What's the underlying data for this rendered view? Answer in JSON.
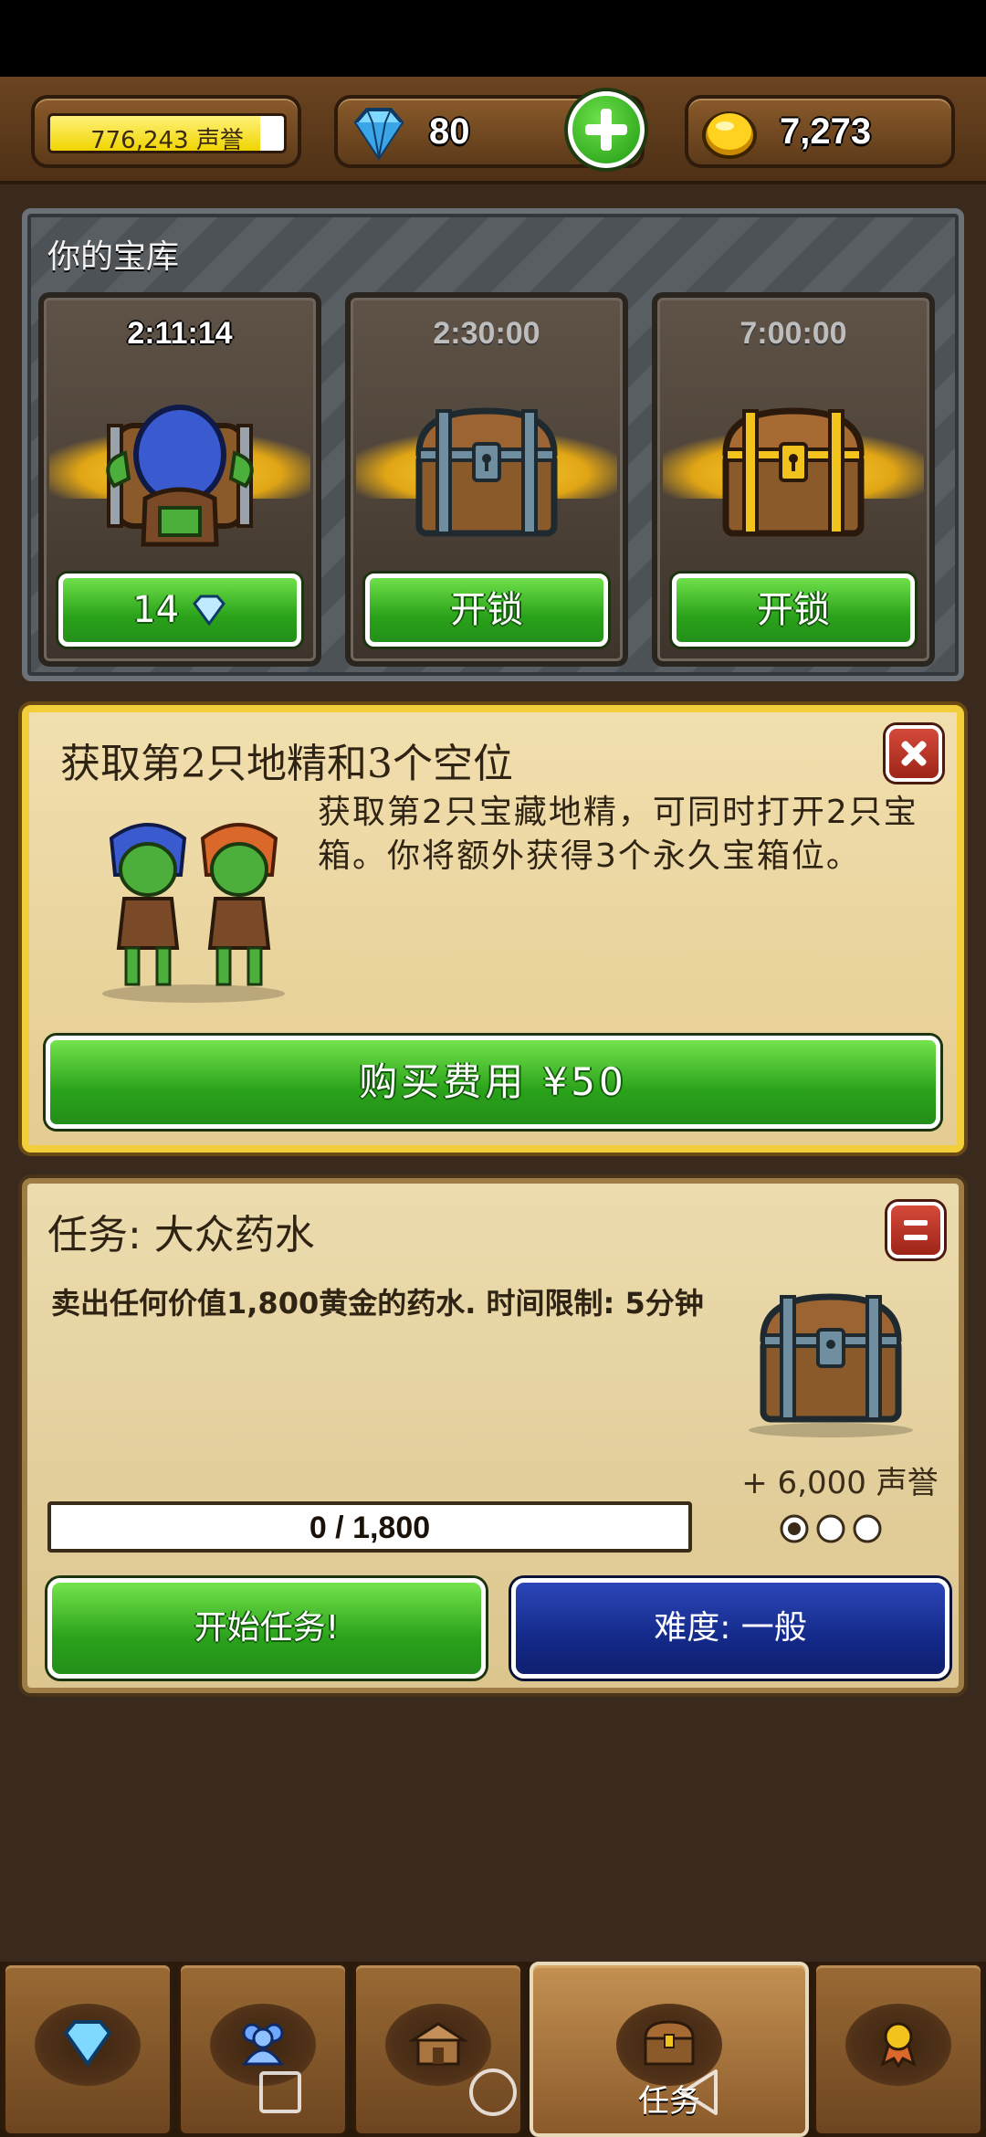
{
  "topbar": {
    "reputation_text": "776,243 声誉",
    "reputation_fill": 0.9,
    "gems": "80",
    "gold": "7,273"
  },
  "vault": {
    "title": "你的宝库",
    "slots": [
      {
        "timer": "2:11:14",
        "button": "14",
        "button_icon": "diamond-icon",
        "chest": "goblin-opening-chest"
      },
      {
        "timer": "2:30:00",
        "button": "开锁",
        "chest": "wooden-chest"
      },
      {
        "timer": "7:00:00",
        "button": "开锁",
        "chest": "gold-chest"
      }
    ]
  },
  "offer": {
    "title": "获取第2只地精和3个空位",
    "description": "获取第2只宝藏地精，可同时打开2只宝箱。你将额外获得3个永久宝箱位。",
    "buy_label": "购买费用 ¥50"
  },
  "quest": {
    "title": "任务: 大众药水",
    "description": "卖出任何价值1,800黄金的药水. 时间限制: 5分钟",
    "progress_text": "0 / 1,800",
    "progress_fraction": 0,
    "reward": "+ 6,000 声誉",
    "difficulty_level": 1,
    "start_label": "开始任务!",
    "difficulty_label": "难度: 一般"
  },
  "tabs": {
    "items": [
      "diamond-icon",
      "people-icon",
      "shop-icon",
      "chest-icon",
      "medal-icon"
    ],
    "active_index": 3,
    "active_label": "任务"
  },
  "colors": {
    "green_button": "#2aa21a",
    "blue_button": "#142a8a",
    "offer_border": "#f2cf3a"
  }
}
